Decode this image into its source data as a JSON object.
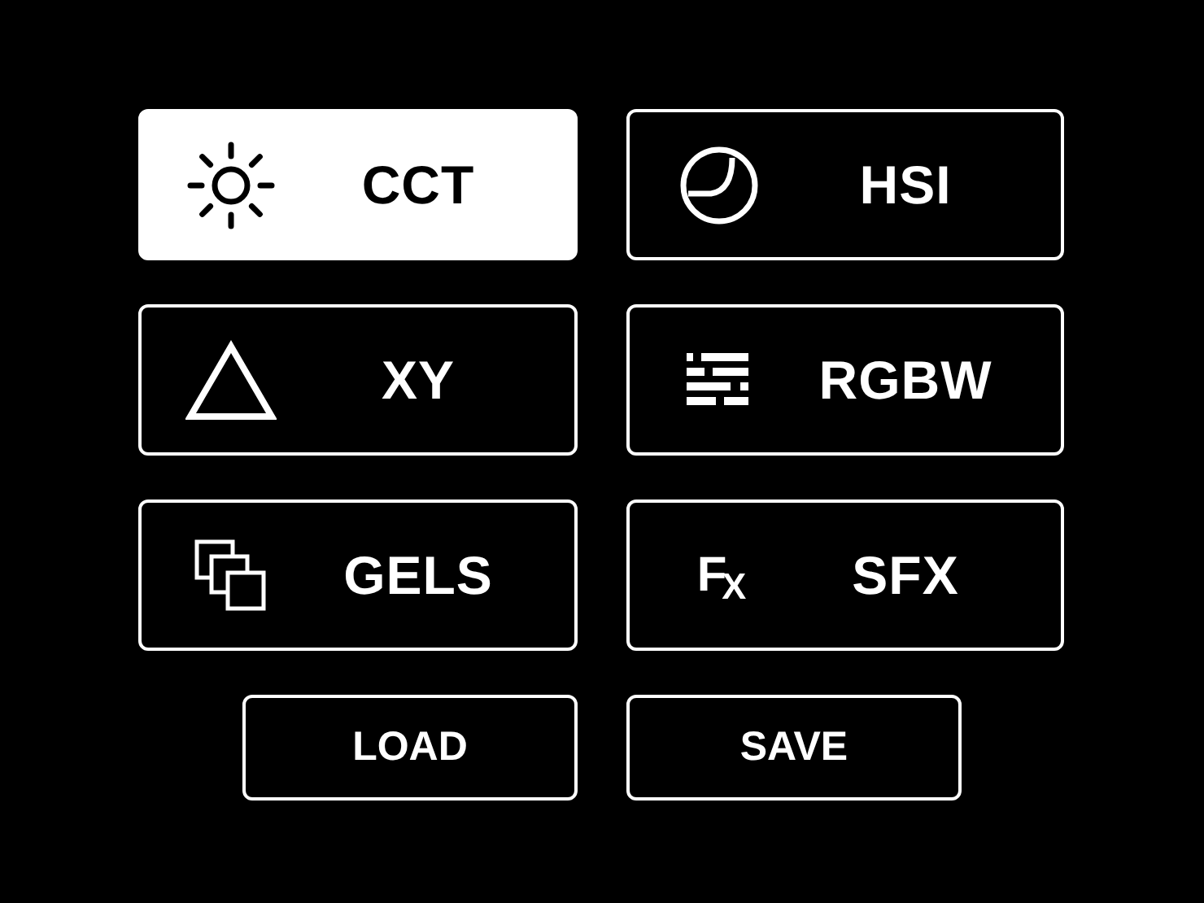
{
  "modes": [
    {
      "label": "CCT",
      "selected": true
    },
    {
      "label": "HSI",
      "selected": false
    },
    {
      "label": "XY",
      "selected": false
    },
    {
      "label": "RGBW",
      "selected": false
    },
    {
      "label": "GELS",
      "selected": false
    },
    {
      "label": "SFX",
      "glyph": "F$_{X}$",
      "selected": false
    }
  ],
  "actions": [
    "LOAD",
    "SAVE"
  ]
}
